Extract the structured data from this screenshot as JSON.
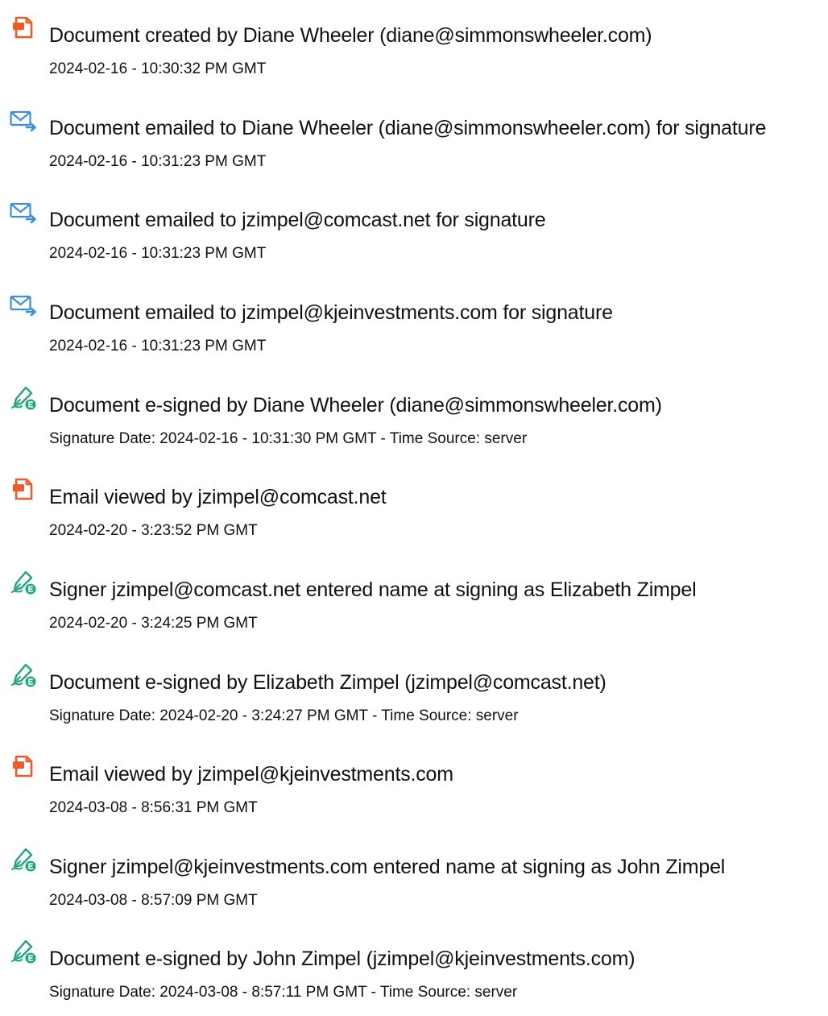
{
  "icons": {
    "document": {
      "name": "document-icon",
      "color": "#F05A28"
    },
    "email": {
      "name": "email-sent-icon",
      "color": "#3B8EDB"
    },
    "signed": {
      "name": "pen-signed-icon",
      "color": "#1FA67A"
    }
  },
  "entries": [
    {
      "icon": "document",
      "title": "Document created by Diane Wheeler (diane@simmonswheeler.com)",
      "meta": "2024-02-16 - 10:30:32 PM GMT"
    },
    {
      "icon": "email",
      "title": "Document emailed to Diane Wheeler (diane@simmonswheeler.com) for signature",
      "meta": "2024-02-16 - 10:31:23 PM GMT"
    },
    {
      "icon": "email",
      "title": "Document emailed to jzimpel@comcast.net for signature",
      "meta": "2024-02-16 - 10:31:23 PM GMT"
    },
    {
      "icon": "email",
      "title": "Document emailed to jzimpel@kjeinvestments.com for signature",
      "meta": "2024-02-16 - 10:31:23 PM GMT"
    },
    {
      "icon": "signed",
      "title": "Document e-signed by Diane Wheeler (diane@simmonswheeler.com)",
      "meta": "Signature Date: 2024-02-16 - 10:31:30 PM GMT - Time Source: server"
    },
    {
      "icon": "document",
      "title": "Email viewed by jzimpel@comcast.net",
      "meta": "2024-02-20 - 3:23:52 PM GMT"
    },
    {
      "icon": "signed",
      "title": "Signer jzimpel@comcast.net entered name at signing as Elizabeth Zimpel",
      "meta": "2024-02-20 - 3:24:25 PM GMT"
    },
    {
      "icon": "signed",
      "title": "Document e-signed by Elizabeth Zimpel (jzimpel@comcast.net)",
      "meta": "Signature Date: 2024-02-20 - 3:24:27 PM GMT - Time Source: server"
    },
    {
      "icon": "document",
      "title": "Email viewed by jzimpel@kjeinvestments.com",
      "meta": "2024-03-08 - 8:56:31 PM GMT"
    },
    {
      "icon": "signed",
      "title": "Signer jzimpel@kjeinvestments.com entered name at signing as John Zimpel",
      "meta": "2024-03-08 - 8:57:09 PM GMT"
    },
    {
      "icon": "signed",
      "title": "Document e-signed by John Zimpel (jzimpel@kjeinvestments.com)",
      "meta": "Signature Date: 2024-03-08 - 8:57:11 PM GMT - Time Source: server"
    }
  ]
}
